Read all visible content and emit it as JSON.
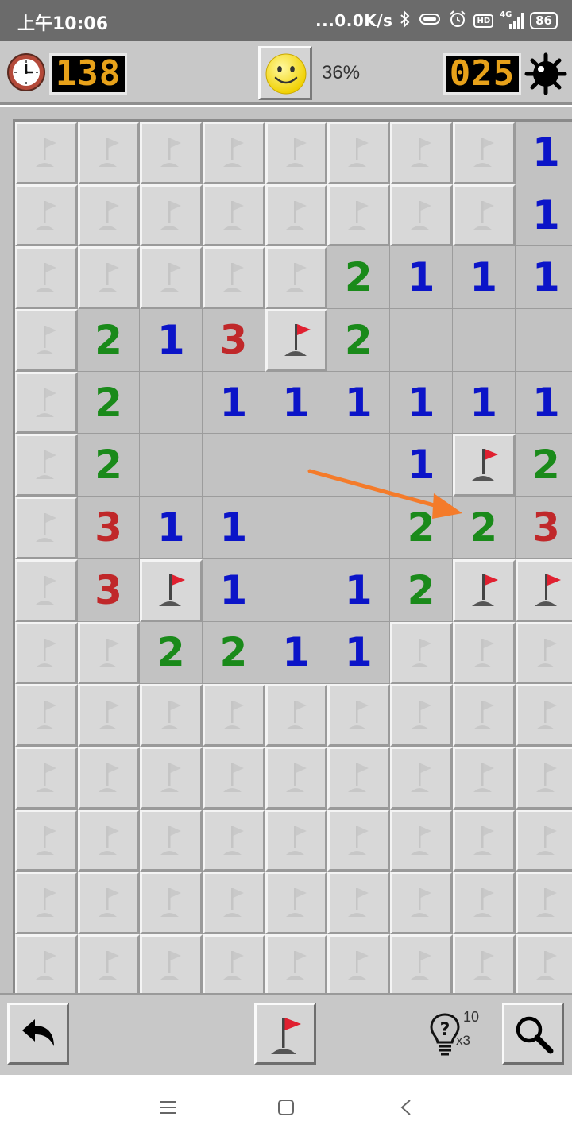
{
  "status_bar": {
    "time": "上午10:06",
    "network_speed": "...0.0K/s",
    "hd_badge": "HD",
    "signal_label": "4G",
    "battery": "86",
    "icons": [
      "bluetooth-icon",
      "vibrate-icon",
      "alarm-icon",
      "hd-icon",
      "signal-icon",
      "battery-icon"
    ]
  },
  "game_header": {
    "timer": "138",
    "mines_remaining": "025",
    "progress": "36%",
    "clock_icon": "clock-icon",
    "face_icon": "smiley-face-icon",
    "mine_icon": "mine-icon"
  },
  "board": {
    "columns": 9,
    "rows_visible": 14,
    "legend": "H = hidden, F = flag, 0 = open empty, digit = adjacent mine count",
    "number_colors": {
      "1": "#0b14c8",
      "2": "#1a8a1a",
      "3": "#c0282a"
    },
    "rows": [
      [
        "H",
        "H",
        "H",
        "H",
        "H",
        "H",
        "H",
        "H",
        "1"
      ],
      [
        "H",
        "H",
        "H",
        "H",
        "H",
        "H",
        "H",
        "H",
        "1"
      ],
      [
        "H",
        "H",
        "H",
        "H",
        "H",
        "2",
        "1",
        "1",
        "1"
      ],
      [
        "H",
        "2",
        "1",
        "3",
        "F",
        "2",
        "0",
        "0",
        "0"
      ],
      [
        "H",
        "2",
        "0",
        "1",
        "1",
        "1",
        "1",
        "1",
        "1"
      ],
      [
        "H",
        "2",
        "0",
        "0",
        "0",
        "0",
        "1",
        "F",
        "2"
      ],
      [
        "H",
        "3",
        "1",
        "1",
        "0",
        "0",
        "2",
        "2",
        "3"
      ],
      [
        "H",
        "3",
        "F",
        "1",
        "0",
        "1",
        "2",
        "F",
        "F"
      ],
      [
        "H",
        "H",
        "2",
        "2",
        "1",
        "1",
        "H",
        "H",
        "H"
      ],
      [
        "H",
        "H",
        "H",
        "H",
        "H",
        "H",
        "H",
        "H",
        "H"
      ],
      [
        "H",
        "H",
        "H",
        "H",
        "H",
        "H",
        "H",
        "H",
        "H"
      ],
      [
        "H",
        "H",
        "H",
        "H",
        "H",
        "H",
        "H",
        "H",
        "H"
      ],
      [
        "H",
        "H",
        "H",
        "H",
        "H",
        "H",
        "H",
        "H",
        "H"
      ],
      [
        "H",
        "H",
        "H",
        "H",
        "H",
        "H",
        "H",
        "H",
        "H"
      ]
    ]
  },
  "annotation": {
    "type": "arrow",
    "color": "#f47b2a",
    "points_to": "row 7, column 8"
  },
  "toolbar": {
    "undo_icon": "undo-icon",
    "flag_mode_icon": "flag-icon",
    "hint_icon": "lightbulb-question-icon",
    "hint_count": "10",
    "hint_multiplier": "x3",
    "zoom_icon": "magnifier-icon"
  },
  "nav_bar": {
    "icons": [
      "menu-icon",
      "home-icon",
      "back-icon"
    ]
  }
}
